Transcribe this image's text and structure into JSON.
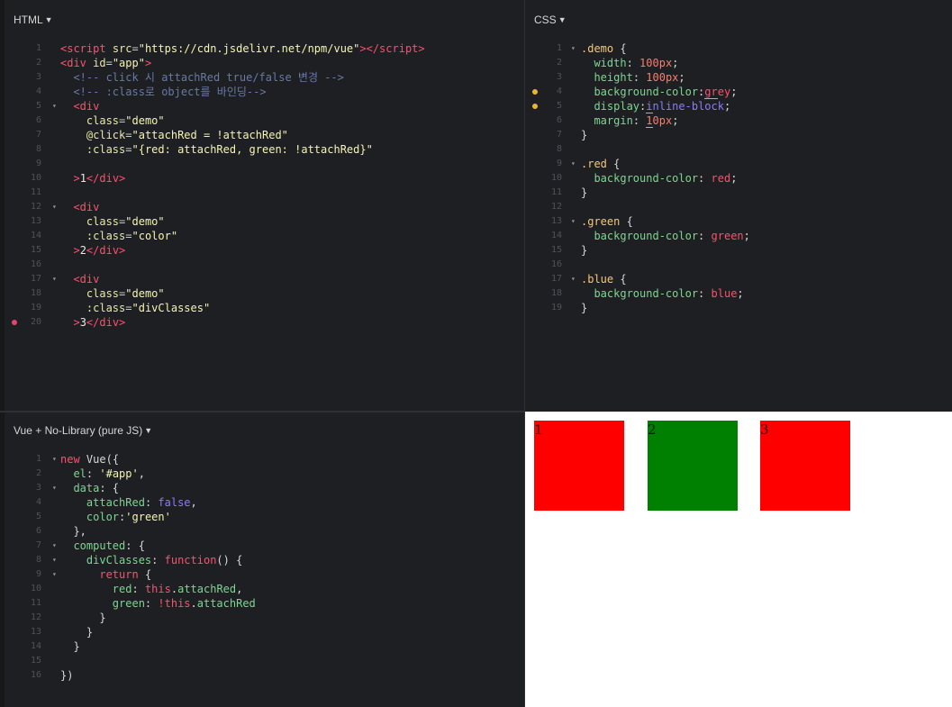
{
  "html_panel": {
    "title": "HTML",
    "lines": [
      {
        "n": "1",
        "fold": "",
        "dot": "",
        "html": "<span class='t-tag'>&lt;script</span> <span class='t-attr'>src</span>=<span class='t-str'>\"https://cdn.jsdelivr.net/npm/vue\"</span><span class='t-tag'>&gt;&lt;/script&gt;</span>"
      },
      {
        "n": "2",
        "fold": "",
        "dot": "",
        "html": "<span class='t-tag'>&lt;div</span> <span class='t-attr'>id</span>=<span class='t-str'>\"app\"</span><span class='t-tag'>&gt;</span>"
      },
      {
        "n": "3",
        "fold": "",
        "dot": "",
        "html": "  <span class='t-com'>&lt;!-- click 시 attachRed true/false 변경 --&gt;</span>"
      },
      {
        "n": "4",
        "fold": "",
        "dot": "",
        "html": "  <span class='t-com'>&lt;!-- :class로 object를 바인딩--&gt;</span>"
      },
      {
        "n": "5",
        "fold": "▾",
        "dot": "",
        "html": "  <span class='t-tag'>&lt;div</span>"
      },
      {
        "n": "6",
        "fold": "",
        "dot": "",
        "html": "    <span class='t-attr'>class</span>=<span class='t-str'>\"demo\"</span>"
      },
      {
        "n": "7",
        "fold": "",
        "dot": "",
        "html": "    <span class='t-attr'>@click</span>=<span class='t-str'>\"attachRed = !attachRed\"</span>"
      },
      {
        "n": "8",
        "fold": "",
        "dot": "",
        "html": "    <span class='t-attr'>:class</span>=<span class='t-str'>\"{red: attachRed, green: !attachRed}\"</span>"
      },
      {
        "n": "9",
        "fold": "",
        "dot": "",
        "html": ""
      },
      {
        "n": "10",
        "fold": "",
        "dot": "",
        "html": "  <span class='t-tag'>&gt;</span><span class='t-txt'>1</span><span class='t-tag'>&lt;/div&gt;</span>"
      },
      {
        "n": "11",
        "fold": "",
        "dot": "",
        "html": ""
      },
      {
        "n": "12",
        "fold": "▾",
        "dot": "",
        "html": "  <span class='t-tag'>&lt;div</span>"
      },
      {
        "n": "13",
        "fold": "",
        "dot": "",
        "html": "    <span class='t-attr'>class</span>=<span class='t-str'>\"demo\"</span>"
      },
      {
        "n": "14",
        "fold": "",
        "dot": "",
        "html": "    <span class='t-attr'>:class</span>=<span class='t-str'>\"color\"</span>"
      },
      {
        "n": "15",
        "fold": "",
        "dot": "",
        "html": "  <span class='t-tag'>&gt;</span><span class='t-txt'>2</span><span class='t-tag'>&lt;/div&gt;</span>"
      },
      {
        "n": "16",
        "fold": "",
        "dot": "",
        "html": ""
      },
      {
        "n": "17",
        "fold": "▾",
        "dot": "",
        "html": "  <span class='t-tag'>&lt;div</span>"
      },
      {
        "n": "18",
        "fold": "",
        "dot": "",
        "html": "    <span class='t-attr'>class</span>=<span class='t-str'>\"demo\"</span>"
      },
      {
        "n": "19",
        "fold": "",
        "dot": "",
        "html": "    <span class='t-attr'>:class</span>=<span class='t-str'>\"divClasses\"</span>"
      },
      {
        "n": "20",
        "fold": "",
        "dot": "#e0476a",
        "html": "  <span class='t-tag'>&gt;</span><span class='t-txt'>3</span><span class='t-tag'>&lt;/div&gt;</span>"
      }
    ]
  },
  "css_panel": {
    "title": "CSS",
    "lines": [
      {
        "n": "1",
        "fold": "▾",
        "dot": "",
        "html": "<span class='t-sel'>.demo</span> <span class='t-pl'>{</span>"
      },
      {
        "n": "2",
        "fold": "",
        "dot": "",
        "html": "  <span class='t-prop'>width</span><span class='t-pl'>:</span> <span class='t-num'>100px</span><span class='t-pl'>;</span>"
      },
      {
        "n": "3",
        "fold": "",
        "dot": "",
        "html": "  <span class='t-prop'>height</span><span class='t-pl'>:</span> <span class='t-num'>100px</span><span class='t-pl'>;</span>"
      },
      {
        "n": "4",
        "fold": "",
        "dot": "#f0b33a",
        "html": "  <span class='t-prop'>background-color</span><span class='t-pl'>:</span><span class='t-val squig'>gr</span><span class='t-val'>ey</span><span class='t-pl'>;</span>"
      },
      {
        "n": "5",
        "fold": "",
        "dot": "#f0b33a",
        "html": "  <span class='t-prop'>display</span><span class='t-pl'>:</span><span class='t-blue squig'>i</span><span class='t-blue'>nline-block</span><span class='t-pl'>;</span>"
      },
      {
        "n": "6",
        "fold": "",
        "dot": "",
        "html": "  <span class='t-prop'>margin</span><span class='t-pl'>:</span> <span class='t-num squig'>1</span><span class='t-num'>0px</span><span class='t-pl'>;</span>"
      },
      {
        "n": "7",
        "fold": "",
        "dot": "",
        "html": "<span class='t-pl'>}</span>"
      },
      {
        "n": "8",
        "fold": "",
        "dot": "",
        "html": ""
      },
      {
        "n": "9",
        "fold": "▾",
        "dot": "",
        "html": "<span class='t-sel'>.red</span> <span class='t-pl'>{</span>"
      },
      {
        "n": "10",
        "fold": "",
        "dot": "",
        "html": "  <span class='t-prop'>background-color</span><span class='t-pl'>:</span> <span class='t-val'>red</span><span class='t-pl'>;</span>"
      },
      {
        "n": "11",
        "fold": "",
        "dot": "",
        "html": "<span class='t-pl'>}</span>"
      },
      {
        "n": "12",
        "fold": "",
        "dot": "",
        "html": ""
      },
      {
        "n": "13",
        "fold": "▾",
        "dot": "",
        "html": "<span class='t-sel'>.green</span> <span class='t-pl'>{</span>"
      },
      {
        "n": "14",
        "fold": "",
        "dot": "",
        "html": "  <span class='t-prop'>background-color</span><span class='t-pl'>:</span> <span class='t-val'>green</span><span class='t-pl'>;</span>"
      },
      {
        "n": "15",
        "fold": "",
        "dot": "",
        "html": "<span class='t-pl'>}</span>"
      },
      {
        "n": "16",
        "fold": "",
        "dot": "",
        "html": ""
      },
      {
        "n": "17",
        "fold": "▾",
        "dot": "",
        "html": "<span class='t-sel'>.blue</span> <span class='t-pl'>{</span>"
      },
      {
        "n": "18",
        "fold": "",
        "dot": "",
        "html": "  <span class='t-prop'>background-color</span><span class='t-pl'>:</span> <span class='t-val'>blue</span><span class='t-pl'>;</span>"
      },
      {
        "n": "19",
        "fold": "",
        "dot": "",
        "html": "<span class='t-pl'>}</span>"
      }
    ]
  },
  "js_panel": {
    "title": "Vue + No-Library (pure JS)",
    "lines": [
      {
        "n": "1",
        "fold": "▾",
        "dot": "",
        "html": "<span class='t-kw'>new</span> <span class='t-pl'>Vue({</span>"
      },
      {
        "n": "2",
        "fold": "",
        "dot": "",
        "html": "  <span class='t-green'>el</span><span class='t-pl'>:</span> <span class='t-jsstr'>'#app'</span><span class='t-pl'>,</span>"
      },
      {
        "n": "3",
        "fold": "▾",
        "dot": "",
        "html": "  <span class='t-green'>data</span><span class='t-pl'>: {</span>"
      },
      {
        "n": "4",
        "fold": "",
        "dot": "",
        "html": "    <span class='t-green'>attachRed</span><span class='t-pl'>:</span> <span class='t-bool'>false</span><span class='t-pl'>,</span>"
      },
      {
        "n": "5",
        "fold": "",
        "dot": "",
        "html": "    <span class='t-green'>color</span><span class='t-pl'>:</span><span class='t-jsstr'>'green'</span>"
      },
      {
        "n": "6",
        "fold": "",
        "dot": "",
        "html": "  <span class='t-pl'>},</span>"
      },
      {
        "n": "7",
        "fold": "▾",
        "dot": "",
        "html": "  <span class='t-green'>computed</span><span class='t-pl'>: {</span>"
      },
      {
        "n": "8",
        "fold": "▾",
        "dot": "",
        "html": "    <span class='t-green'>divClasses</span><span class='t-pl'>:</span> <span class='t-kw'>function</span><span class='t-pl'>() {</span>"
      },
      {
        "n": "9",
        "fold": "▾",
        "dot": "",
        "html": "      <span class='t-kw'>return</span> <span class='t-pl'>{</span>"
      },
      {
        "n": "10",
        "fold": "",
        "dot": "",
        "html": "        <span class='t-green'>red</span><span class='t-pl'>:</span> <span class='t-kw'>this</span><span class='t-pl'>.</span><span class='t-green'>attachRed</span><span class='t-pl'>,</span>"
      },
      {
        "n": "11",
        "fold": "",
        "dot": "",
        "html": "        <span class='t-green'>green</span><span class='t-pl'>:</span> <span class='t-kw'>!this</span><span class='t-pl'>.</span><span class='t-green'>attachRed</span>"
      },
      {
        "n": "12",
        "fold": "",
        "dot": "",
        "html": "      <span class='t-pl'>}</span>"
      },
      {
        "n": "13",
        "fold": "",
        "dot": "",
        "html": "    <span class='t-pl'>}</span>"
      },
      {
        "n": "14",
        "fold": "",
        "dot": "",
        "html": "  <span class='t-pl'>}</span>"
      },
      {
        "n": "15",
        "fold": "",
        "dot": "",
        "html": ""
      },
      {
        "n": "16",
        "fold": "",
        "dot": "",
        "html": "<span class='t-pl'>})</span>"
      }
    ]
  },
  "result_panel": {
    "boxes": [
      {
        "label": "1",
        "color": "#ff0000"
      },
      {
        "label": "2",
        "color": "#008000"
      },
      {
        "label": "3",
        "color": "#ff0000"
      }
    ]
  },
  "dropdown_icon": "caret-down-icon",
  "breakpoint_color": "#e0476a",
  "warning_color": "#f0b33a"
}
